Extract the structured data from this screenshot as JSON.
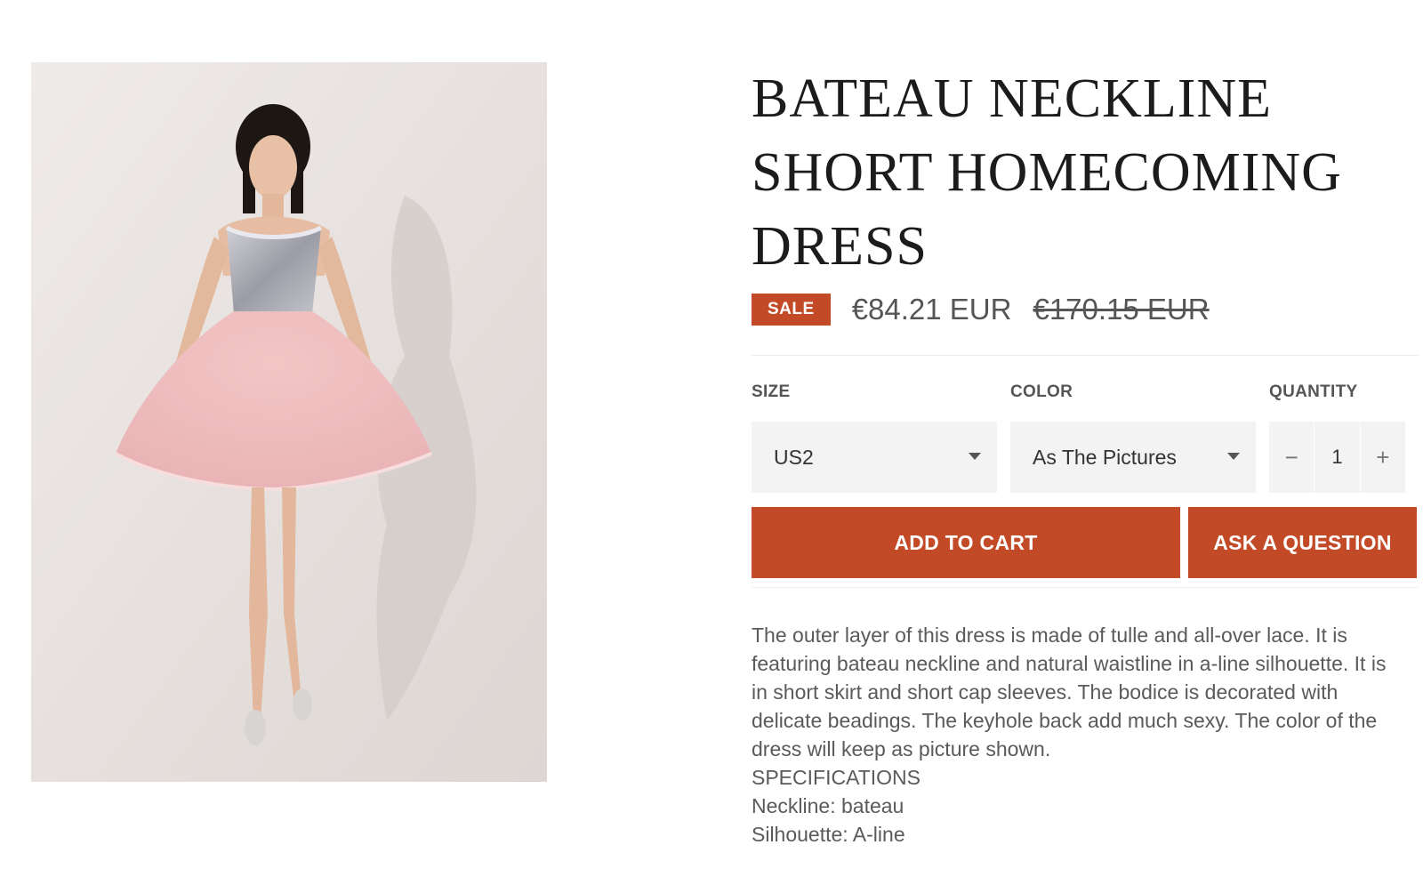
{
  "product": {
    "title": "BATEAU NECKLINE SHORT HOMECOMING DRESS",
    "image_alt": "Pink short homecoming dress with beaded bodice",
    "sale_badge": "SALE",
    "price": "€84.21 EUR",
    "compare_price": "€170.15 EUR"
  },
  "options": {
    "size": {
      "label": "SIZE",
      "value": "US2"
    },
    "color": {
      "label": "COLOR",
      "value": "As The Pictures"
    },
    "quantity": {
      "label": "QUANTITY",
      "value": "1",
      "minus": "−",
      "plus": "+"
    }
  },
  "actions": {
    "add_to_cart": "ADD TO CART",
    "ask_question": "ASK A QUESTION"
  },
  "description": {
    "paragraph": "The outer layer of this dress is made of tulle and all-over lace. It is featuring bateau neckline and natural waistline in a-line silhouette. It is in short skirt and short cap sleeves. The bodice is decorated with delicate beadings. The keyhole back add much sexy. The color of the dress will keep as picture shown.",
    "spec_heading": "SPECIFICATIONS",
    "spec_neckline": "Neckline: bateau",
    "spec_silhouette": "Silhouette: A-line"
  },
  "colors": {
    "accent": "#c34a26",
    "select_bg": "#f3f3f3"
  }
}
